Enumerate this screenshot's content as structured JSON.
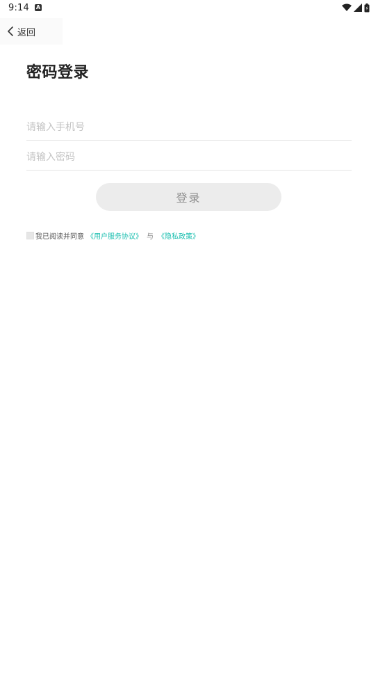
{
  "status_bar": {
    "time": "9:14",
    "notification_icon": "A"
  },
  "nav": {
    "back_label": "返回"
  },
  "page": {
    "title": "密码登录"
  },
  "form": {
    "phone_placeholder": "请输入手机号",
    "phone_value": "",
    "password_placeholder": "请输入密码",
    "password_value": "",
    "login_label": "登录"
  },
  "agreement": {
    "text": "我已阅读并同意",
    "user_agreement_link": "《用户服务协议》",
    "and_text": "与",
    "privacy_link": "《隐私政策》",
    "link_color": "#1bbfb0",
    "checked": false
  }
}
